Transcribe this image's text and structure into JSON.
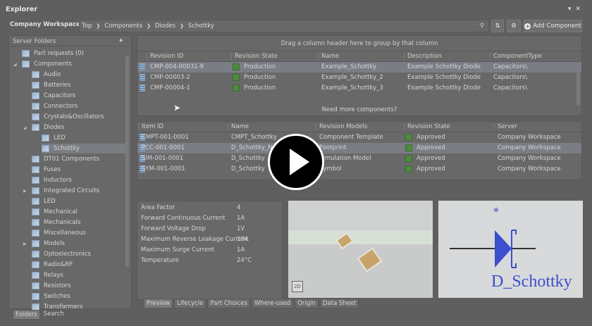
{
  "window": {
    "title": "Explorer",
    "menu_icon": "dropdown-arrow-icon",
    "close_icon": "close-icon"
  },
  "toolbar": {
    "workspace": "Company Workspace ▾",
    "breadcrumb": [
      "Top",
      "Components",
      "Diodes",
      "Schottky"
    ],
    "add_component": "Add Component",
    "refresh_icon": "refresh-icon",
    "settings_icon": "gear-icon",
    "search_icon": "search-icon"
  },
  "sidebar": {
    "header": "Server Folders",
    "items": [
      {
        "label": "Part requests (0)",
        "level": 0
      },
      {
        "label": "Components",
        "level": 0,
        "expanded": true
      },
      {
        "label": "Audio",
        "level": 1
      },
      {
        "label": "Batteries",
        "level": 1
      },
      {
        "label": "Capacitors",
        "level": 1
      },
      {
        "label": "Connectors",
        "level": 1
      },
      {
        "label": "Crystals&Oscillators",
        "level": 1
      },
      {
        "label": "Diodes",
        "level": 1,
        "expanded": true
      },
      {
        "label": "LED",
        "level": 2
      },
      {
        "label": "Schottky",
        "level": 2,
        "selected": true
      },
      {
        "label": "DT01 Components",
        "level": 1
      },
      {
        "label": "Fuses",
        "level": 1
      },
      {
        "label": "Inductors",
        "level": 1
      },
      {
        "label": "Integrated Circuits",
        "level": 1,
        "collapsed": true
      },
      {
        "label": "LED",
        "level": 1
      },
      {
        "label": "Mechanical",
        "level": 1
      },
      {
        "label": "Mechanicals",
        "level": 1
      },
      {
        "label": "Miscellaneous",
        "level": 1
      },
      {
        "label": "Models",
        "level": 1,
        "collapsed": true
      },
      {
        "label": "Optoelectronics",
        "level": 1
      },
      {
        "label": "Radio&RF",
        "level": 1
      },
      {
        "label": "Relays",
        "level": 1
      },
      {
        "label": "Resistors",
        "level": 1
      },
      {
        "label": "Switches",
        "level": 1
      },
      {
        "label": "Transformers",
        "level": 1
      }
    ],
    "tabs": [
      "Folders",
      "Search"
    ]
  },
  "components": {
    "group_hint": "Drag a column header here to group by that column",
    "columns": [
      "Revision ID",
      "Revision State",
      "Name",
      "Description",
      "ComponentType"
    ],
    "rows": [
      [
        "CMP-004-00031-9",
        "Production",
        "Example_Schottky",
        "Example Schottky Diode",
        "Capacitors\\"
      ],
      [
        "CMP-00003-2",
        "Production",
        "Example_Schottky_2",
        "Example Schottky Diode",
        "Capacitors\\"
      ],
      [
        "CMP-00004-1",
        "Production",
        "Example_Schottky_3",
        "Example Schottky Diode",
        "Capacitors\\"
      ]
    ],
    "more": "Need more components?"
  },
  "models": {
    "columns": [
      "Item ID",
      "Name",
      "Revision Models",
      "Revision State",
      "Server"
    ],
    "rows": [
      [
        "CMPT-001-0001",
        "CMPT_Schottky",
        "Component Template",
        "Approved",
        "Company Workspace"
      ],
      [
        "PCC-001-0001",
        "D_Schottky_N",
        "Footprint",
        "Approved",
        "Company Workspace"
      ],
      [
        "SIM-001-0001",
        "D_Schottky",
        "Simulation Model",
        "Approved",
        "Company Workspace"
      ],
      [
        "SYM-001-0001",
        "D_Schottky",
        "Symbol",
        "Approved",
        "Company Workspace"
      ]
    ]
  },
  "parameters": [
    [
      "Area Factor",
      "4"
    ],
    [
      "Forward Continuous Current",
      "1A"
    ],
    [
      "Forward Voltage Drop",
      "1V"
    ],
    [
      "Maximum Reverse Leakage Current",
      "10A"
    ],
    [
      "Maximum Surge Current",
      "1A"
    ],
    [
      "Temperature",
      "24°C"
    ]
  ],
  "preview": {
    "mode_button": "2D",
    "symbol_label": "D_Schottky",
    "symbol_designator": "*"
  },
  "detail_tabs": [
    "Preview",
    "Lifecycle",
    "Part Choices",
    "Where-used",
    "Origin",
    "Data Sheet"
  ],
  "colors": {
    "state_green": "#4e8a3e",
    "symbol_blue": "#3b4fcf"
  }
}
